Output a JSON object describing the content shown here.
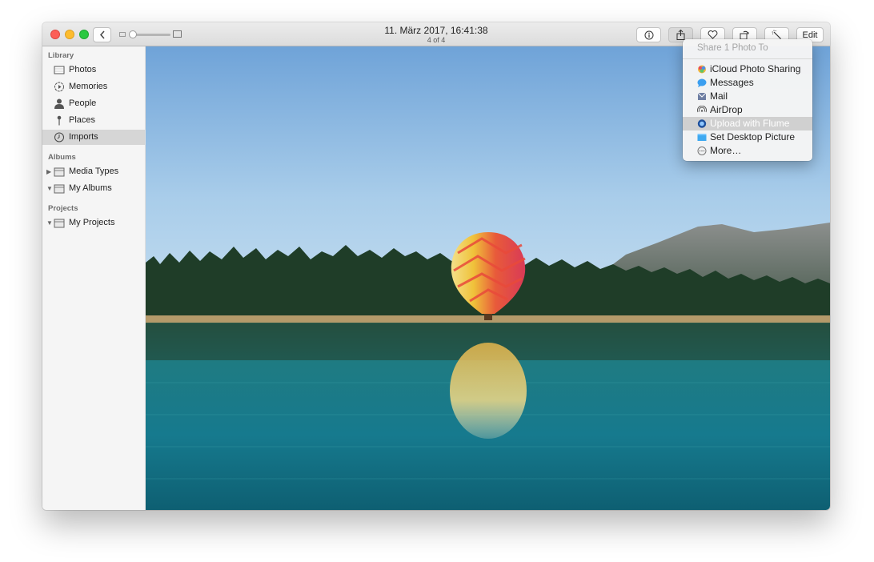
{
  "titlebar": {
    "date": "11. März 2017, 16:41:38",
    "count": "4 of 4",
    "edit_label": "Edit"
  },
  "sidebar": {
    "library_head": "Library",
    "albums_head": "Albums",
    "projects_head": "Projects",
    "library_items": [
      {
        "label": "Photos",
        "icon": "photos-icon"
      },
      {
        "label": "Memories",
        "icon": "memories-icon"
      },
      {
        "label": "People",
        "icon": "people-icon"
      },
      {
        "label": "Places",
        "icon": "places-pin-icon"
      },
      {
        "label": "Imports",
        "icon": "clock-icon",
        "selected": true
      }
    ],
    "albums_items": [
      {
        "label": "Media Types",
        "icon": "album-folder-icon",
        "expanded": false
      },
      {
        "label": "My Albums",
        "icon": "album-folder-icon",
        "expanded": true
      }
    ],
    "projects_items": [
      {
        "label": "My Projects",
        "icon": "album-folder-icon",
        "expanded": true
      }
    ]
  },
  "share_menu": {
    "header": "Share 1 Photo To",
    "items": [
      {
        "label": "iCloud Photo Sharing",
        "icon": "icloud-photo-sharing-icon"
      },
      {
        "label": "Messages",
        "icon": "messages-icon"
      },
      {
        "label": "Mail",
        "icon": "mail-icon"
      },
      {
        "label": "AirDrop",
        "icon": "airdrop-icon"
      },
      {
        "label": "Upload with Flume",
        "icon": "flume-icon",
        "highlighted": true
      },
      {
        "label": "Set Desktop Picture",
        "icon": "desktop-picture-icon"
      },
      {
        "label": "More…",
        "icon": "more-icon"
      }
    ]
  },
  "colors": {
    "close": "#fc5f57",
    "minimize": "#fdbc2e",
    "maximize": "#2ac840",
    "sidebar_selected": "#d6d6d6"
  }
}
